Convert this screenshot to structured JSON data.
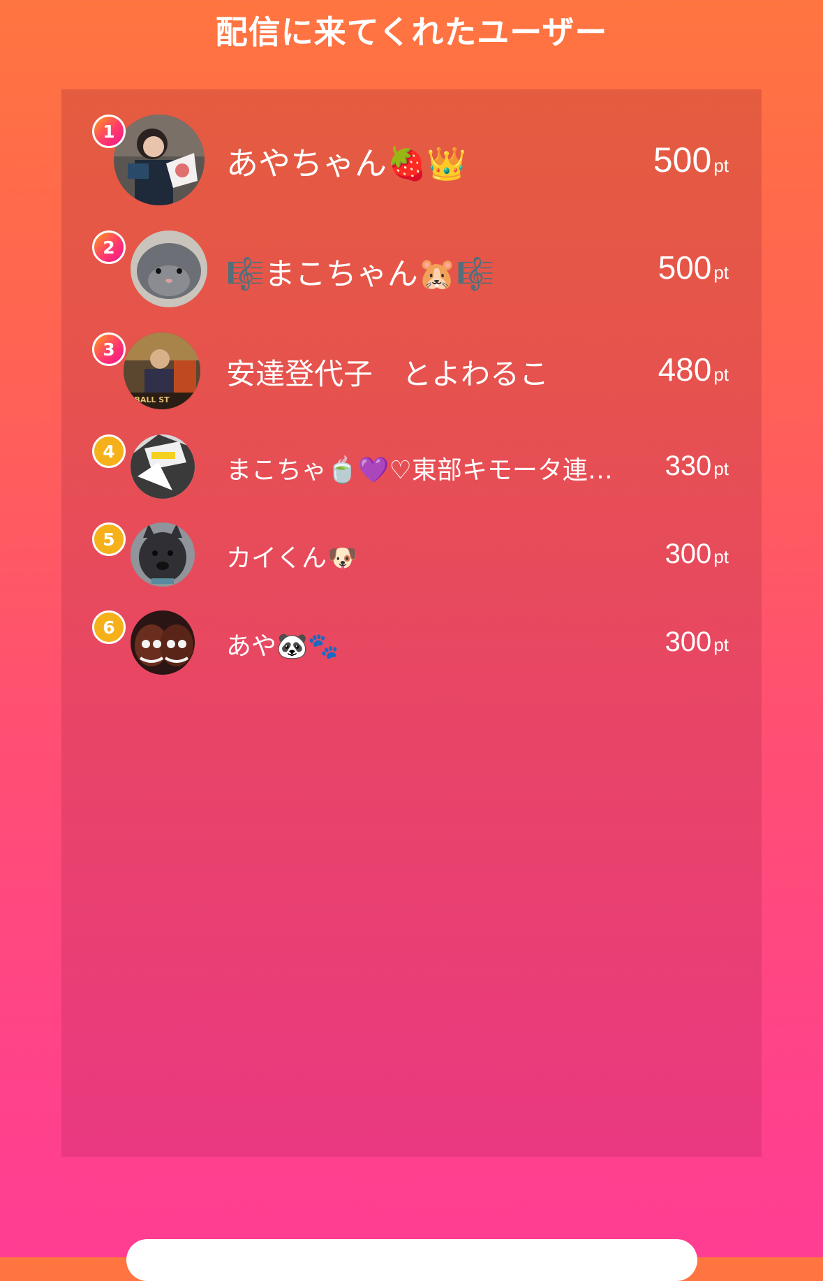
{
  "header": {
    "title": "配信に来てくれたユーザー"
  },
  "ranking": [
    {
      "rank": "1",
      "name": "あやちゃん🍓👑",
      "points": "500",
      "unit": "pt"
    },
    {
      "rank": "2",
      "name": "🎼まこちゃん🐹🎼",
      "points": "500",
      "unit": "pt"
    },
    {
      "rank": "3",
      "name": "安達登代子　とよわるこ",
      "points": "480",
      "unit": "pt"
    },
    {
      "rank": "4",
      "name": "まこちゃ🍵💜♡東部キモータ連…",
      "points": "330",
      "unit": "pt"
    },
    {
      "rank": "5",
      "name": "カイくん🐶",
      "points": "300",
      "unit": "pt"
    },
    {
      "rank": "6",
      "name": "あや🐼🐾",
      "points": "300",
      "unit": "pt"
    }
  ],
  "colors": {
    "badge_top": "#ff3b6b",
    "badge_gold": "#f5b01a",
    "background_top": "#ff7540",
    "background_bottom": "#ff3d93"
  }
}
